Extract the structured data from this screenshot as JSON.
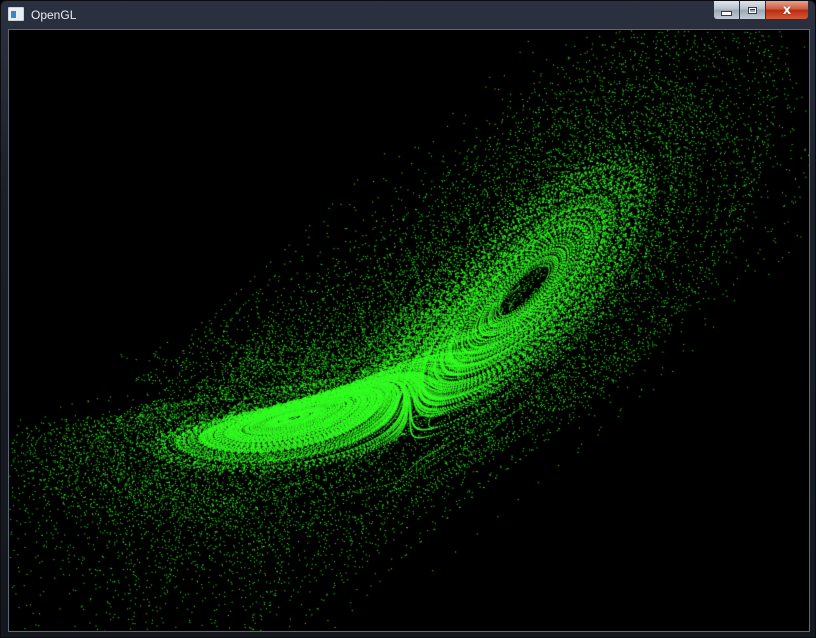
{
  "window": {
    "title": "OpenGL",
    "close_label": "x"
  },
  "scene": {
    "background_color": "#000000",
    "point_color": "#33ff22",
    "content": "lorenz-attractor-point-cloud"
  }
}
